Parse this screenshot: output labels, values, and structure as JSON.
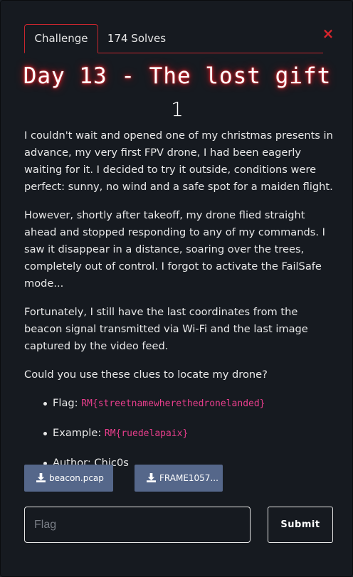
{
  "tabs": {
    "challenge": "Challenge",
    "solves": "174 Solves"
  },
  "close": {
    "label": "×"
  },
  "challenge": {
    "name": "Day 13 - The lost gift",
    "value": "1",
    "paragraphs": [
      "I couldn't wait and opened one of my christmas presents in advance, my very first FPV drone, I had been eagerly waiting for it. I decided to try it outside, conditions were perfect: sunny, no wind and a safe spot for a maiden flight.",
      "However, shortly after takeoff, my drone flied straight ahead and stopped responding to any of my commands. I saw it disappear in a distance, soaring over the trees, completely out of control. I forgot to activate the FailSafe mode...",
      "Fortunately, I still have the last coordinates from the beacon signal transmitted via Wi-Fi and the last image captured by the video feed.",
      "Could you use these clues to locate my drone?"
    ],
    "meta": {
      "flag_label": "Flag:",
      "flag_format": "RM{streetnamewherethedronelanded}",
      "example_label": "Example:",
      "example_value": "RM{ruedelapaix}",
      "author_text": "Author: Chic0s"
    },
    "files": [
      {
        "name": "beacon.pcap",
        "icon": "download-icon"
      },
      {
        "name": "FRAME1057...",
        "icon": "download-icon"
      }
    ]
  },
  "form": {
    "flag_placeholder": "Flag",
    "flag_value": "",
    "submit_label": "Submit"
  },
  "colors": {
    "background": "#161a20",
    "accent": "#c8262e",
    "close": "#d9252d",
    "code": "#e83e8c",
    "file_button": "#55678a"
  }
}
